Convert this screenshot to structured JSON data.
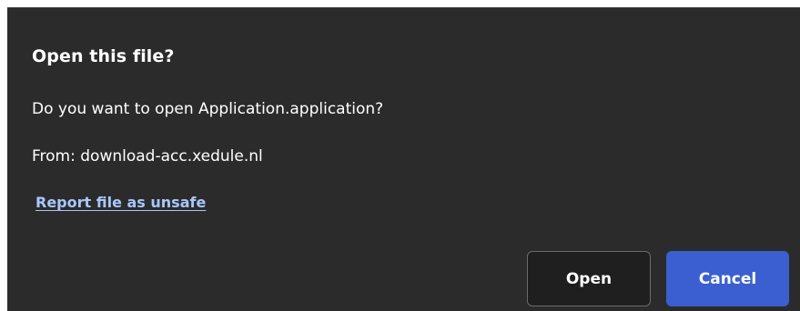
{
  "dialog": {
    "title": "Open this file?",
    "message": "Do you want to open Application.application?",
    "source": "From: download-acc.xedule.nl",
    "report_link": "Report file as unsafe",
    "buttons": {
      "open_label": "Open",
      "cancel_label": "Cancel"
    }
  },
  "colors": {
    "background": "#2b2b2b",
    "link": "#a8c7fa",
    "primary_button": "#3b5fd0",
    "secondary_button": "#1f1f1f"
  }
}
